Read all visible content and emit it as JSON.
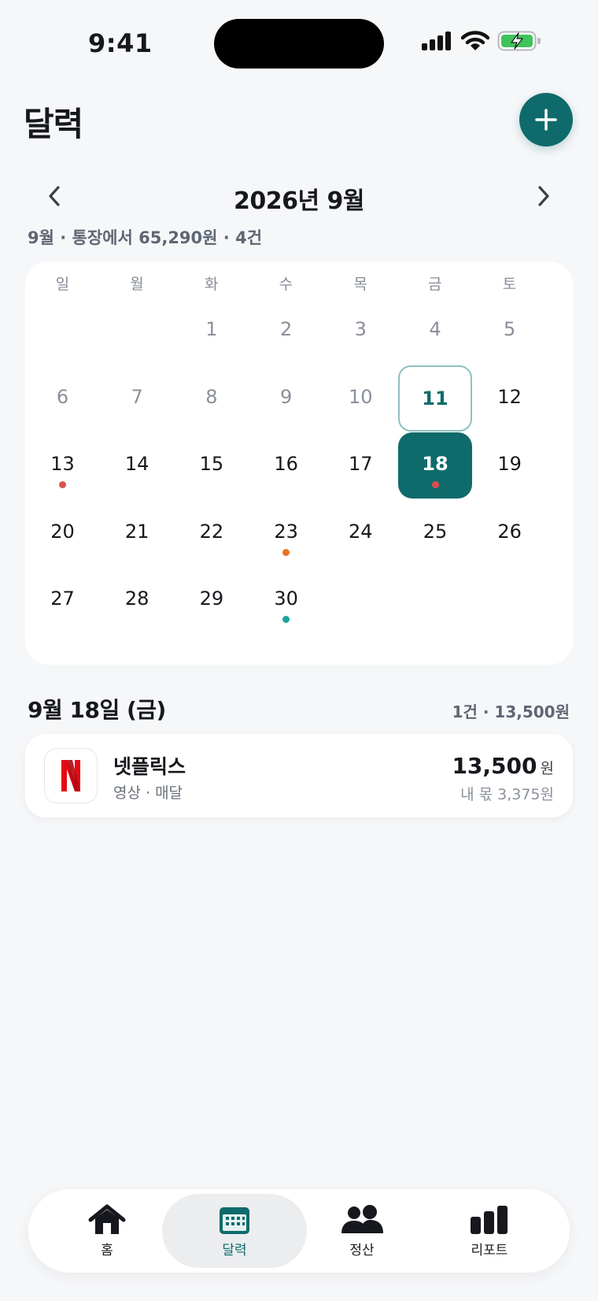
{
  "status": {
    "time": "9:41"
  },
  "header": {
    "title": "달력"
  },
  "month_nav": {
    "label": "2026년 9월",
    "summary": "9월 · 통장에서 65,290원 · 4건"
  },
  "calendar": {
    "weekdays": [
      "일",
      "월",
      "화",
      "수",
      "목",
      "금",
      "토"
    ],
    "days": [
      {
        "day": "1",
        "state": "past"
      },
      {
        "day": "2",
        "state": "past"
      },
      {
        "day": "3",
        "state": "past"
      },
      {
        "day": "4",
        "state": "past"
      },
      {
        "day": "5",
        "state": "past"
      },
      {
        "day": "6",
        "state": "past"
      },
      {
        "day": "7",
        "state": "past"
      },
      {
        "day": "8",
        "state": "past"
      },
      {
        "day": "9",
        "state": "past"
      },
      {
        "day": "10",
        "state": "past"
      },
      {
        "day": "11",
        "state": "today"
      },
      {
        "day": "12",
        "state": "normal"
      },
      {
        "day": "13",
        "state": "normal",
        "dot": "#d9534f"
      },
      {
        "day": "14",
        "state": "normal"
      },
      {
        "day": "15",
        "state": "normal"
      },
      {
        "day": "16",
        "state": "normal"
      },
      {
        "day": "17",
        "state": "normal"
      },
      {
        "day": "18",
        "state": "selected",
        "dot": "#e04b4b"
      },
      {
        "day": "19",
        "state": "normal"
      },
      {
        "day": "20",
        "state": "normal"
      },
      {
        "day": "21",
        "state": "normal"
      },
      {
        "day": "22",
        "state": "normal"
      },
      {
        "day": "23",
        "state": "normal",
        "dot": "#e8741c"
      },
      {
        "day": "24",
        "state": "normal"
      },
      {
        "day": "25",
        "state": "normal"
      },
      {
        "day": "26",
        "state": "normal"
      },
      {
        "day": "27",
        "state": "normal"
      },
      {
        "day": "28",
        "state": "normal"
      },
      {
        "day": "29",
        "state": "normal"
      },
      {
        "day": "30",
        "state": "normal",
        "dot": "#1aa39a"
      }
    ]
  },
  "selected": {
    "date_label": "9월 18일 (금)",
    "summary": "1건 · 13,500원",
    "items": [
      {
        "name": "넷플릭스",
        "meta": "영상 · 매달",
        "amount": "13,500",
        "unit": "원",
        "share": "내 몫 3,375원",
        "icon": "netflix-logo"
      }
    ]
  },
  "tabs": [
    {
      "label": "홈",
      "icon": "home-icon",
      "active": false
    },
    {
      "label": "달력",
      "icon": "calendar-icon",
      "active": true
    },
    {
      "label": "정산",
      "icon": "people-icon",
      "active": false
    },
    {
      "label": "리포트",
      "icon": "bar-chart-icon",
      "active": false
    }
  ],
  "colors": {
    "accent": "#0f6b6b",
    "background": "#f6f7f9"
  }
}
